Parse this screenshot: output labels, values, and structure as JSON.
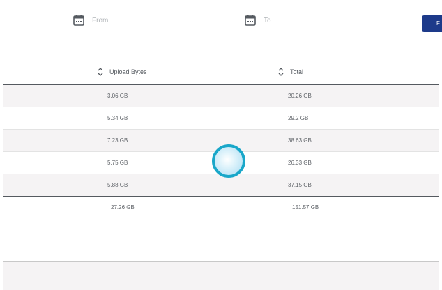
{
  "filters": {
    "from_placeholder": "From",
    "to_placeholder": "To",
    "from_icon": "calendar-icon",
    "to_icon": "calendar-icon",
    "filter_button_label": "F"
  },
  "table": {
    "columns": {
      "upload": "Upload Bytes",
      "total": "Total",
      "sort_icon": "sort-icon"
    },
    "rows": [
      {
        "upload": "3.06 GB",
        "total": "20.26 GB"
      },
      {
        "upload": "5.34 GB",
        "total": "29.2 GB"
      },
      {
        "upload": "7.23 GB",
        "total": "38.63 GB"
      },
      {
        "upload": "5.75 GB",
        "total": "26.33 GB"
      },
      {
        "upload": "5.88 GB",
        "total": "37.15 GB"
      }
    ],
    "totals": {
      "upload": "27.26 GB",
      "total": "151.57 GB"
    }
  },
  "colors": {
    "accent": "#1d3a8a",
    "row_stripe": "#f5f3f4",
    "cursor_ring": "#19a7c9"
  }
}
